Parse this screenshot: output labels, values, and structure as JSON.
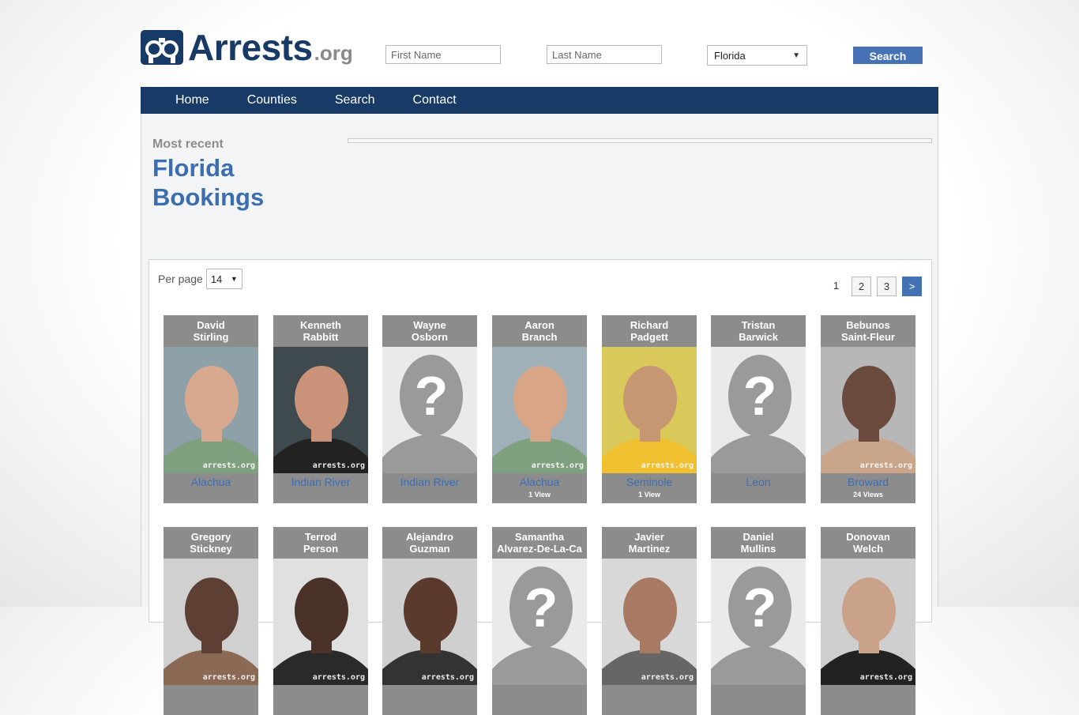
{
  "site": {
    "logo_text": "Arrests",
    "logo_tld": ".org"
  },
  "search": {
    "first_placeholder": "First Name",
    "last_placeholder": "Last Name",
    "state_value": "Florida",
    "button_label": "Search"
  },
  "nav": {
    "items": [
      "Home",
      "Counties",
      "Search",
      "Contact"
    ]
  },
  "heading": {
    "kicker": "Most recent",
    "line1": "Florida",
    "line2": "Bookings"
  },
  "listing": {
    "per_page_label": "Per page",
    "per_page_value": "14",
    "pages": [
      "1",
      "2",
      "3"
    ],
    "next_label": ">"
  },
  "watermark": "arrests.org",
  "bookings": [
    {
      "first": "David",
      "last": "Stirling",
      "county": "Alachua",
      "views": ""
    },
    {
      "first": "Kenneth",
      "last": "Rabbitt",
      "county": "Indian River",
      "views": ""
    },
    {
      "first": "Wayne",
      "last": "Osborn",
      "county": "Indian River",
      "views": ""
    },
    {
      "first": "Aaron",
      "last": "Branch",
      "county": "Alachua",
      "views": "1 View"
    },
    {
      "first": "Richard",
      "last": "Padgett",
      "county": "Seminole",
      "views": "1 View"
    },
    {
      "first": "Tristan",
      "last": "Barwick",
      "county": "Leon",
      "views": ""
    },
    {
      "first": "Bebunos",
      "last": "Saint-Fleur",
      "county": "Broward",
      "views": "24 Views"
    },
    {
      "first": "Gregory",
      "last": "Stickney",
      "county": "",
      "views": ""
    },
    {
      "first": "Terrod",
      "last": "Person",
      "county": "",
      "views": ""
    },
    {
      "first": "Alejandro",
      "last": "Guzman",
      "county": "",
      "views": ""
    },
    {
      "first": "Samantha",
      "last": "Alvarez-De-La-Ca",
      "county": "",
      "views": ""
    },
    {
      "first": "Javier",
      "last": "Martinez",
      "county": "",
      "views": ""
    },
    {
      "first": "Daniel",
      "last": "Mullins",
      "county": "",
      "views": ""
    },
    {
      "first": "Donovan",
      "last": "Welch",
      "county": "",
      "views": ""
    }
  ]
}
